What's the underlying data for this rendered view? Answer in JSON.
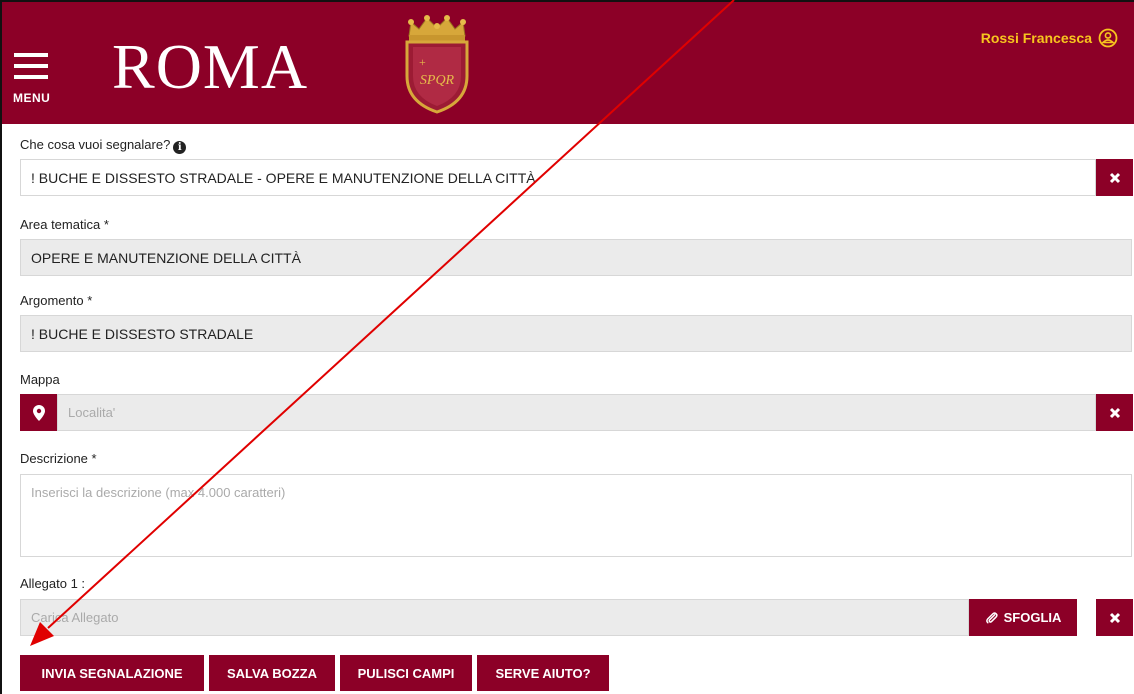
{
  "header": {
    "menu_label": "MENU",
    "logo_text": "ROMA",
    "emblem_text": "SPQR",
    "user_name": "Rossi Francesca"
  },
  "form": {
    "what_label": "Che cosa vuoi segnalare?",
    "what_value": "! BUCHE E DISSESTO STRADALE - OPERE E MANUTENZIONE DELLA CITTÀ",
    "area_label": "Area tematica *",
    "area_value": "OPERE E MANUTENZIONE DELLA CITTÀ",
    "topic_label": "Argomento *",
    "topic_value": "! BUCHE E DISSESTO STRADALE",
    "map_label": "Mappa",
    "map_placeholder": "Localita'",
    "desc_label": "Descrizione *",
    "desc_placeholder": "Inserisci la descrizione (max 4.000 caratteri)",
    "attach_label": "Allegato 1 :",
    "attach_placeholder": "Carica Allegato",
    "browse_label": "SFOGLIA"
  },
  "actions": {
    "send": "INVIA SEGNALAZIONE",
    "save_draft": "SALVA BOZZA",
    "clear": "PULISCI CAMPI",
    "help": "SERVE AIUTO?"
  },
  "colors": {
    "brand": "#8c0027",
    "user_accent": "#f7c51e",
    "annotation_arrow": "#e00000"
  },
  "icons": [
    "menu-icon",
    "user-icon",
    "info-icon",
    "close-icon",
    "map-marker-icon",
    "paperclip-icon"
  ]
}
